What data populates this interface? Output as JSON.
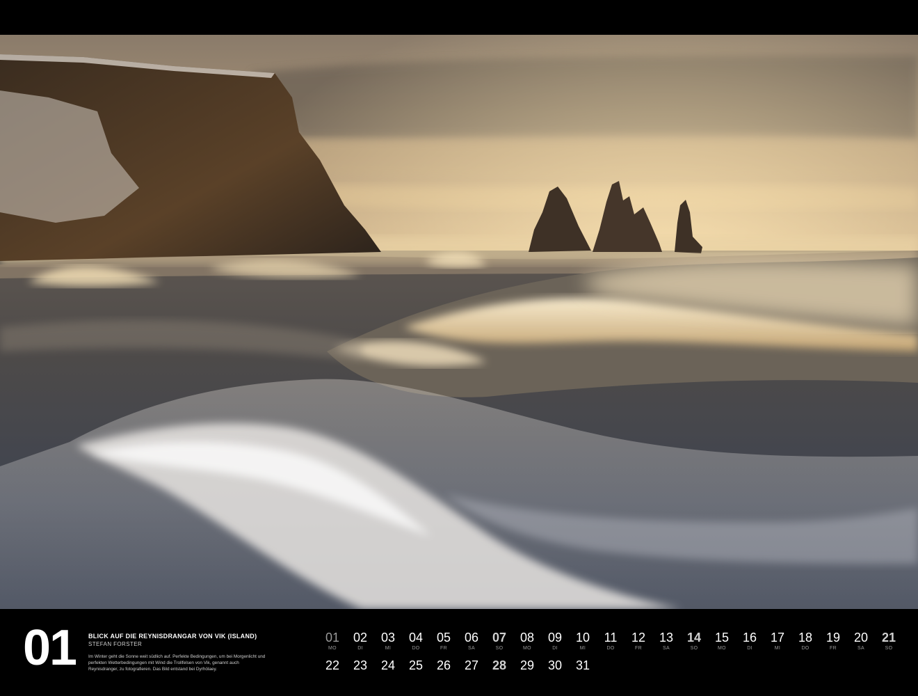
{
  "month": {
    "number": "01"
  },
  "caption": {
    "title": "BLICK AUF DIE REYNISDRANGAR VON VIK (ISLAND)",
    "author": "STEFAN FORSTER",
    "text": "Im Winter geht die Sonne weit südlich auf. Perfekte Bedingungen, um bei Morgenlicht und perfekten Wetterbedingungen mit Wind die Trollfelsen von Vik, genannt auch Reynisdranger, zu fotografieren. Das Bild entstand bei Dyrhólaey."
  },
  "days_row1": [
    {
      "num": "01",
      "wd": "MO",
      "style": "dim"
    },
    {
      "num": "02",
      "wd": "DI",
      "style": "normal"
    },
    {
      "num": "03",
      "wd": "MI",
      "style": "normal"
    },
    {
      "num": "04",
      "wd": "DO",
      "style": "normal"
    },
    {
      "num": "05",
      "wd": "FR",
      "style": "normal"
    },
    {
      "num": "06",
      "wd": "SA",
      "style": "normal"
    },
    {
      "num": "07",
      "wd": "SO",
      "style": "bold"
    },
    {
      "num": "08",
      "wd": "MO",
      "style": "normal"
    },
    {
      "num": "09",
      "wd": "DI",
      "style": "normal"
    },
    {
      "num": "10",
      "wd": "MI",
      "style": "normal"
    },
    {
      "num": "11",
      "wd": "DO",
      "style": "normal"
    },
    {
      "num": "12",
      "wd": "FR",
      "style": "normal"
    },
    {
      "num": "13",
      "wd": "SA",
      "style": "normal"
    },
    {
      "num": "14",
      "wd": "SO",
      "style": "bold"
    },
    {
      "num": "15",
      "wd": "MO",
      "style": "normal"
    },
    {
      "num": "16",
      "wd": "DI",
      "style": "normal"
    },
    {
      "num": "17",
      "wd": "MI",
      "style": "normal"
    },
    {
      "num": "18",
      "wd": "DO",
      "style": "normal"
    },
    {
      "num": "19",
      "wd": "FR",
      "style": "normal"
    },
    {
      "num": "20",
      "wd": "SA",
      "style": "normal"
    },
    {
      "num": "21",
      "wd": "SO",
      "style": "bold"
    }
  ],
  "days_row2": [
    {
      "num": "22",
      "style": "normal"
    },
    {
      "num": "23",
      "style": "normal"
    },
    {
      "num": "24",
      "style": "normal"
    },
    {
      "num": "25",
      "style": "normal"
    },
    {
      "num": "26",
      "style": "normal"
    },
    {
      "num": "27",
      "style": "normal"
    },
    {
      "num": "28",
      "style": "bold"
    },
    {
      "num": "29",
      "style": "normal"
    },
    {
      "num": "30",
      "style": "normal"
    },
    {
      "num": "31",
      "style": "normal"
    }
  ]
}
